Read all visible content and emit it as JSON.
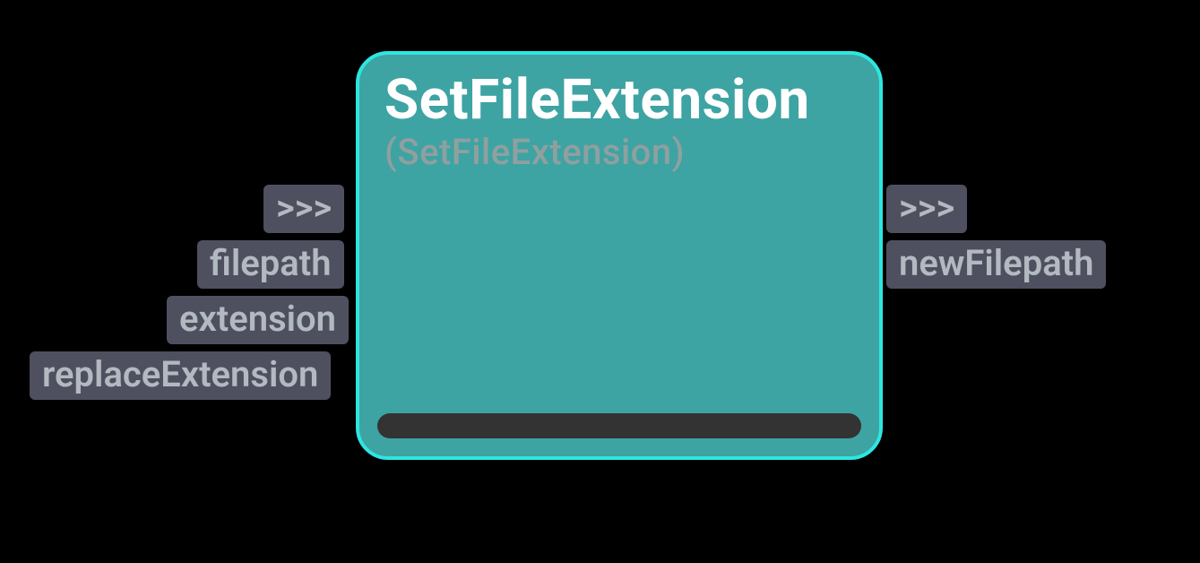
{
  "node": {
    "title": "SetFileExtension",
    "subtitle": "(SetFileExtension)"
  },
  "inputs": {
    "exec": ">>>",
    "filepath": "filepath",
    "extension": "extension",
    "replaceExtension": "replaceExtension"
  },
  "outputs": {
    "exec": ">>>",
    "newFilepath": "newFilepath"
  }
}
